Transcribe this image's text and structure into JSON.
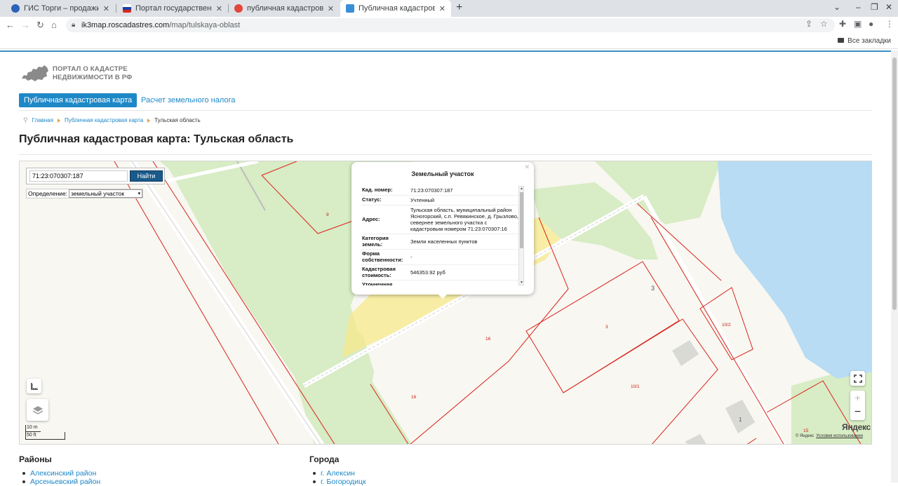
{
  "browser": {
    "tabs": [
      {
        "title": "ГИС Торги – продажи госуд",
        "favicon_color": "#2a63b8"
      },
      {
        "title": "Портал государственных у",
        "favicon_color": "#d52b1e"
      },
      {
        "title": "публичная кадастровая кар",
        "favicon_color": "#e3463a"
      },
      {
        "title": "Публичная кадастровая ка",
        "favicon_color": "#3a8ed8"
      }
    ],
    "url_host": "ik3map.roscadastres.com",
    "url_path": "/map/tulskaya-oblast",
    "bookmarks_all": "Все закладки"
  },
  "site": {
    "logo_line1": "ПОРТАЛ О КАДАСТРЕ",
    "logo_line2": "НЕДВИЖИМОСТИ В РФ",
    "nav": {
      "active": "Публичная кадастровая карта",
      "tax": "Расчет земельного налога"
    },
    "breadcrumbs": {
      "home": "Главная",
      "map": "Публичная кадастровая карта",
      "current": "Тульская область"
    },
    "page_title": "Публичная кадастровая карта: Тульская область"
  },
  "map": {
    "search_value": "71:23:070307:187",
    "search_button": "Найти",
    "definition_label": "Определение:",
    "definition_value": "земельный участок",
    "popup": {
      "title": "Земельный участок",
      "rows": [
        {
          "key": "Кад. номер:",
          "value": "71:23:070307:187"
        },
        {
          "key": "Статус:",
          "value": "Учтенный"
        },
        {
          "key": "Адрес:",
          "value": "Тульская область, муниципальный район Ясногорский, с.п. Ревякинское, д. Грызлово, севернее земельного участка с кадастровым номером 71:23:070307:16"
        },
        {
          "key": "Категория земель:",
          "value": "Земли населенных пунктов"
        },
        {
          "key": "Форма собственности:",
          "value": "-"
        },
        {
          "key": "Кадастровая стоимость:",
          "value": "546353.92 руб"
        },
        {
          "key": "Уточненная",
          "value": ""
        }
      ]
    },
    "labels": {
      "p9": "9",
      "p16a": "16",
      "p16b": "16",
      "p3": "3",
      "p3b": "3",
      "p10_2": "10/2",
      "p10_1": "10/1",
      "p1": "1",
      "p15": "15"
    },
    "scale_top": "10 m",
    "scale_bottom": "50 ft",
    "yandex": "Яндекс",
    "copyright": "© Яндекс",
    "terms": "Условия использования",
    "colors": {
      "water": "#b7dcf4",
      "green": "#d8ecc5",
      "parcel_line": "#d9231d",
      "selected": "#f7e98a"
    }
  },
  "regions": {
    "title": "Районы",
    "items": [
      "Алексинский район",
      "Арсеньевский район"
    ]
  },
  "cities": {
    "title": "Города",
    "items": [
      "г. Алексин",
      "г. Богородицк"
    ]
  }
}
